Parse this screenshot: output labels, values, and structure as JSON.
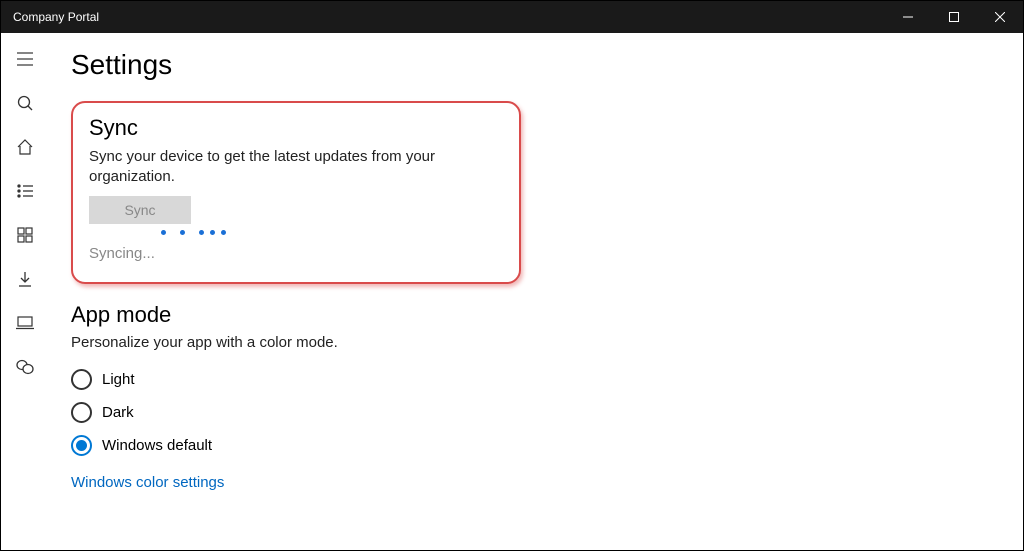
{
  "window": {
    "title": "Company Portal"
  },
  "page": {
    "title": "Settings"
  },
  "sync": {
    "heading": "Sync",
    "description": "Sync your device to get the latest updates from your organization.",
    "buttonLabel": "Sync",
    "status": "Syncing..."
  },
  "appMode": {
    "heading": "App mode",
    "description": "Personalize your app with a color mode.",
    "options": {
      "light": "Light",
      "dark": "Dark",
      "default": "Windows default"
    },
    "link": "Windows color settings"
  }
}
